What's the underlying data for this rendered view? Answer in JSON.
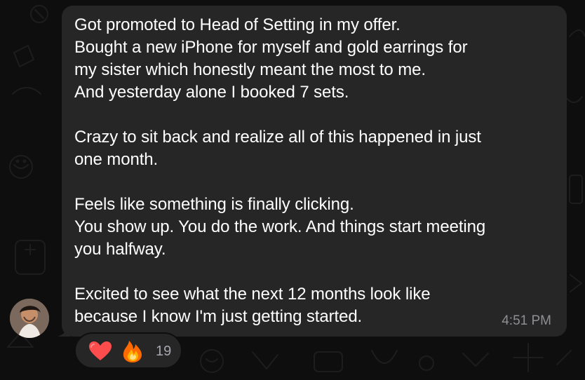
{
  "message": {
    "text": "Got promoted to Head of Setting in my offer.\nBought a new iPhone for myself and gold earrings for\nmy sister which honestly meant the most to me.\nAnd yesterday alone I booked 7 sets.\n\nCrazy to sit back and realize all of this happened in just\none month.\n\nFeels like something is finally clicking.\nYou show up. You do the work. And things start meeting\nyou halfway.\n\nExcited to see what the next 12 months look like\nbecause I know I'm just getting started.",
    "time": "4:51 PM"
  },
  "reactions": {
    "items": [
      {
        "icon": "heart-icon"
      },
      {
        "icon": "fire-icon"
      }
    ],
    "count": "19"
  },
  "colors": {
    "background": "#0e0e0e",
    "bubble": "#262626",
    "text": "#ffffff",
    "muted": "#8e8e93"
  }
}
